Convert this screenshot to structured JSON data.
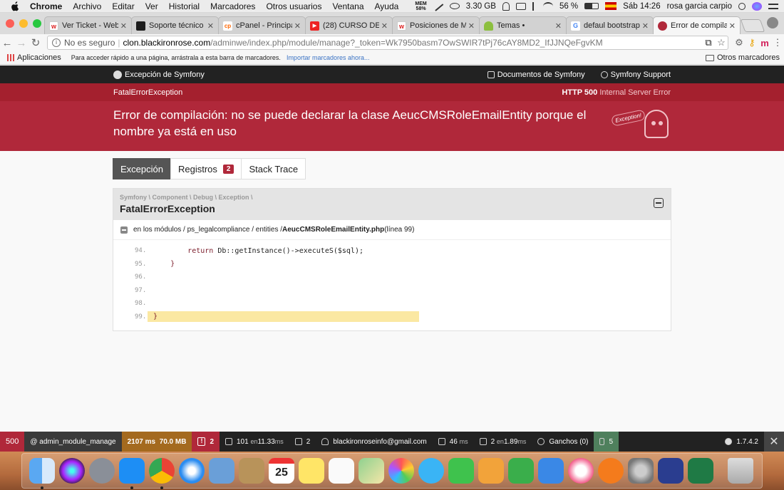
{
  "menubar": {
    "app": "Chrome",
    "items": [
      "Archivo",
      "Editar",
      "Ver",
      "Historial",
      "Marcadores",
      "Otros usuarios",
      "Ventana",
      "Ayuda"
    ],
    "mem_label": "MEM",
    "mem_pct": "58%",
    "disk": "3.30 GB",
    "battery": "56 %",
    "clock": "Sáb 14:26",
    "user": "rosa garcia carpio"
  },
  "tabs": [
    {
      "label": "Ver Ticket - Weber",
      "fav": "w",
      "color": "#ffffff",
      "fg": "#d22"
    },
    {
      "label": "Soporte técnico - ",
      "fav": "",
      "color": "#1c1c1c",
      "fg": "#fff"
    },
    {
      "label": "cPanel - Principal",
      "fav": "cp",
      "color": "#ffffff",
      "fg": "#f60"
    },
    {
      "label": "(28) CURSO DE PR",
      "fav": "▶",
      "color": "#e22",
      "fg": "#fff"
    },
    {
      "label": "Posiciones de Mod",
      "fav": "w",
      "color": "#ffffff",
      "fg": "#d22"
    },
    {
      "label": "Temas •",
      "fav": "",
      "color": "#8cbf3f",
      "fg": "#fff"
    },
    {
      "label": "defaul bootstrap e",
      "fav": "G",
      "color": "#ffffff",
      "fg": "#4285f4"
    },
    {
      "label": "Error de compilació",
      "fav": "",
      "color": "#b0283a",
      "fg": "#fff"
    }
  ],
  "address": {
    "security": "No es seguro",
    "host": "clon.blackironrose.com",
    "path": "/adminwe/index.php/module/manage?_token=Wk7950basm7OwSWIR7tPj76cAY8MD2_IfJJNQeFgvKM"
  },
  "bookmarks": {
    "apps": "Aplicaciones",
    "hint": "Para acceder rápido a una página, arrástrala a esta barra de marcadores.",
    "import": "Importar marcadores ahora...",
    "other": "Otros marcadores"
  },
  "symfony": {
    "brand": "Excepción de Symfony",
    "docs": "Documentos de Symfony",
    "support": "Symfony Support",
    "exception_class": "FatalErrorException",
    "http_code": "HTTP 500",
    "http_text": "Internal Server Error",
    "message": "Error de compilación: no se puede declarar la clase AeucCMSRoleEmailEntity porque el nombre ya está en uso",
    "ghost_label": "Exception!",
    "tabs": {
      "exception": "Excepción",
      "logs": "Registros",
      "logs_count": "2",
      "trace": "Stack Trace"
    },
    "panel": {
      "crumb": "Symfony \\ Component \\ Debug \\ Exception \\",
      "title": "FatalErrorException",
      "trace_prefix": "en los módulos / ps_legalcompliance / entities / ",
      "trace_file": "AeucCMSRoleEmailEntity.php",
      "trace_suffix": " (línea 99)"
    },
    "code": [
      {
        "n": "94.",
        "pre": "        ",
        "kw": "return",
        "rest": " Db::getInstance()->executeS($sql);",
        "hl": false
      },
      {
        "n": "95.",
        "pre": "    ",
        "kw": "",
        "rest": "}",
        "hl": false
      },
      {
        "n": "96.",
        "pre": "",
        "kw": "",
        "rest": "",
        "hl": false
      },
      {
        "n": "97.",
        "pre": "",
        "kw": "",
        "rest": "",
        "hl": false
      },
      {
        "n": "98.",
        "pre": "",
        "kw": "",
        "rest": "",
        "hl": false
      },
      {
        "n": "99.",
        "pre": "",
        "kw": "",
        "rest": "}",
        "hl": true
      }
    ]
  },
  "debugbar": {
    "status": "500",
    "route": "@ admin_module_manage",
    "time": "2107 ms",
    "memory": "70.0 MB",
    "errors": "2",
    "queries": "101",
    "queries_in": "en",
    "queries_time": "11.33",
    "queries_unit": "ms",
    "modules": "2",
    "email": "blackironroseinfo@gmail.com",
    "render": "46",
    "render_unit": "ms",
    "events": "2",
    "events_in": "en",
    "events_time": "1.89",
    "events_unit": "ms",
    "hooks": "Ganchos (0)",
    "hooks_ok": "5",
    "version": "1.7.4.2"
  },
  "dock": {
    "calendar_day": "25"
  },
  "colors": {
    "symfony_red": "#b0283a",
    "symfony_dark_red": "#a4202e",
    "toolbar_dark": "#222222"
  }
}
